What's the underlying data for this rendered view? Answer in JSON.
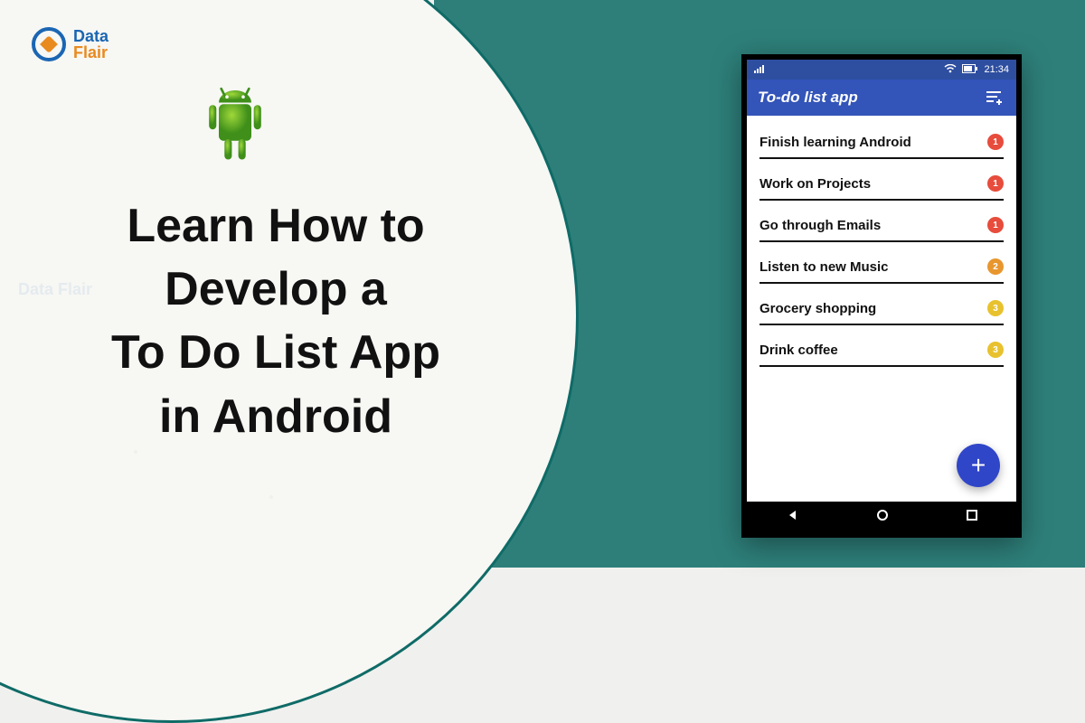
{
  "brand": {
    "name_line1": "Data",
    "name_line2": "Flair"
  },
  "headline": {
    "line1": "Learn How to",
    "line2": "Develop a",
    "line3": "To Do List App",
    "line4": "in Android"
  },
  "phone": {
    "statusbar": {
      "time": "21:34"
    },
    "appbar": {
      "title": "To-do list app"
    },
    "todos": [
      {
        "label": "Finish learning Android",
        "priority": 1
      },
      {
        "label": "Work on Projects",
        "priority": 1
      },
      {
        "label": "Go through Emails",
        "priority": 1
      },
      {
        "label": "Listen to new Music",
        "priority": 2
      },
      {
        "label": "Grocery shopping",
        "priority": 3
      },
      {
        "label": "Drink coffee",
        "priority": 3
      }
    ],
    "fab_label": "+"
  }
}
